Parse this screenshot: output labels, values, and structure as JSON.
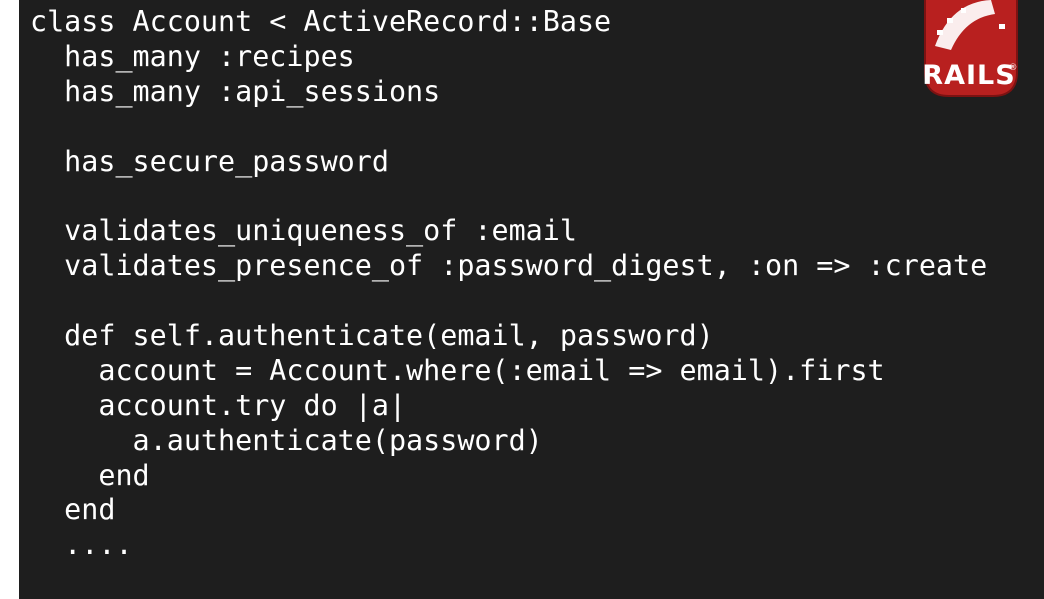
{
  "code": {
    "lines": [
      "class Account < ActiveRecord::Base",
      "  has_many :recipes",
      "  has_many :api_sessions",
      "",
      "  has_secure_password",
      "",
      "  validates_uniqueness_of :email",
      "  validates_presence_of :password_digest, :on => :create",
      "",
      "  def self.authenticate(email, password)",
      "    account = Account.where(:email => email).first",
      "    account.try do |a|",
      "      a.authenticate(password)",
      "    end",
      "  end",
      "  ...."
    ]
  },
  "logo": {
    "text": "RAILS",
    "icon": "rails-logo-icon",
    "color": "#b8201f"
  },
  "colors": {
    "background": "#1e1e1e",
    "text": "#ffffff"
  }
}
